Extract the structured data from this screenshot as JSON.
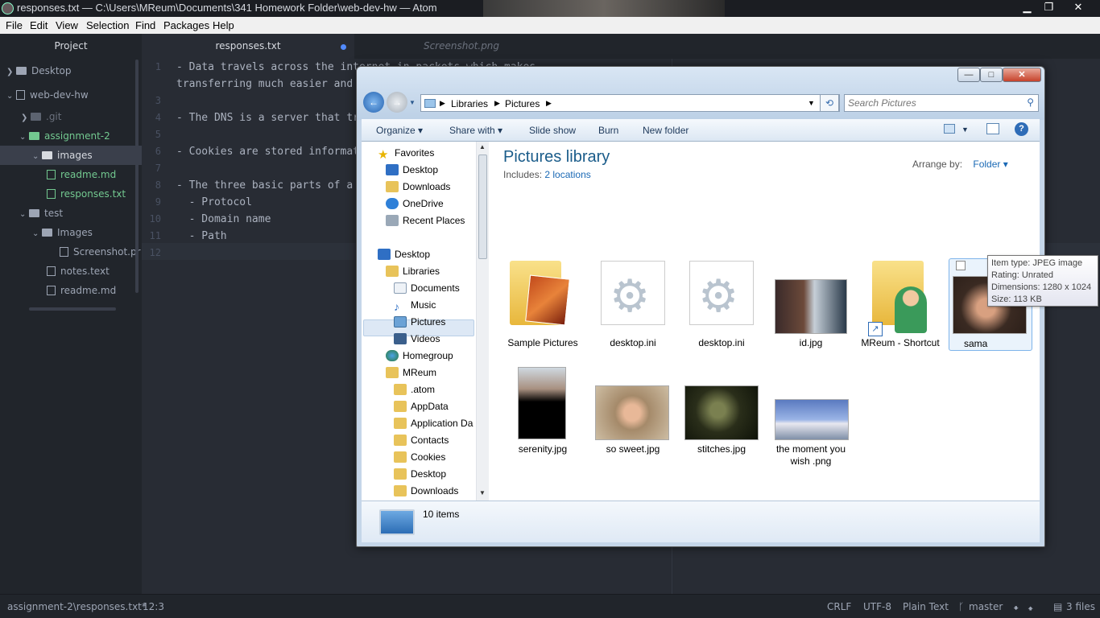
{
  "atom": {
    "window_title": "responses.txt — C:\\Users\\MReum\\Documents\\341 Homework Folder\\web-dev-hw — Atom",
    "menu": [
      "File",
      "Edit",
      "View",
      "Selection",
      "Find",
      "Packages",
      "Help"
    ],
    "tree": {
      "header": "Project",
      "items": [
        {
          "label": "Desktop"
        },
        {
          "label": "web-dev-hw"
        },
        {
          "label": ".git"
        },
        {
          "label": "assignment-2"
        },
        {
          "label": "images"
        },
        {
          "label": "readme.md"
        },
        {
          "label": "responses.txt"
        },
        {
          "label": "test"
        },
        {
          "label": "Images"
        },
        {
          "label": "Screenshot.pr"
        },
        {
          "label": "notes.text"
        },
        {
          "label": "readme.md"
        }
      ]
    },
    "tabs": [
      {
        "label": "responses.txt"
      },
      {
        "label": "Screenshot.png"
      }
    ],
    "code_lines": [
      {
        "num": "1",
        "text": "- Data travels across the internet in packets which makes"
      },
      {
        "num": "",
        "text": "transferring much easier and"
      },
      {
        "num": "3",
        "text": ""
      },
      {
        "num": "4",
        "text": "- The DNS is a server that tr"
      },
      {
        "num": "5",
        "text": ""
      },
      {
        "num": "6",
        "text": "- Cookies are stored informat"
      },
      {
        "num": "7",
        "text": ""
      },
      {
        "num": "8",
        "text": "- The three basic parts of a"
      },
      {
        "num": "9",
        "text": "  - Protocol"
      },
      {
        "num": "10",
        "text": "  - Domain name"
      },
      {
        "num": "11",
        "text": "  - Path"
      },
      {
        "num": "12",
        "text": ""
      }
    ],
    "status": {
      "file_path": "assignment-2\\responses.txt*",
      "cursor": "12:3",
      "line_ending": "CRLF",
      "encoding": "UTF-8",
      "grammar": "Plain Text",
      "branch": "master",
      "files": "3 files"
    }
  },
  "explorer": {
    "caption_buttons": {
      "minimize": "—",
      "maximize": "□",
      "close": "✕"
    },
    "address": {
      "segments": [
        "Libraries",
        "Pictures"
      ]
    },
    "search_placeholder": "Search Pictures",
    "commands": [
      "Organize",
      "Share with",
      "Slide show",
      "Burn",
      "New folder"
    ],
    "nav": {
      "favorites_header": "Favorites",
      "favorites": [
        "Desktop",
        "Downloads",
        "OneDrive",
        "Recent Places"
      ],
      "desktop_header": "Desktop",
      "tree": [
        "Libraries",
        "Documents",
        "Music",
        "Pictures",
        "Videos",
        "Homegroup",
        "MReum",
        ".atom",
        "AppData",
        "Application Da",
        "Contacts",
        "Cookies",
        "Desktop",
        "Downloads"
      ]
    },
    "library_title": "Pictures library",
    "includes_label": "Includes:",
    "includes_link": "2 locations",
    "arrange_label": "Arrange by:",
    "arrange_value": "Folder",
    "items": [
      {
        "label": "Sample Pictures"
      },
      {
        "label": "desktop.ini"
      },
      {
        "label": "desktop.ini"
      },
      {
        "label": "id.jpg"
      },
      {
        "label": "MReum - Shortcut"
      },
      {
        "label": "sama"
      },
      {
        "label": "serenity.jpg"
      },
      {
        "label": "so sweet.jpg"
      },
      {
        "label": "stitches.jpg"
      },
      {
        "label": "the moment you wish .png"
      }
    ],
    "tooltip": [
      "Item type: JPEG image",
      "Rating: Unrated",
      "Dimensions: 1280 x 1024",
      "Size: 113 KB"
    ],
    "item_count": "10 items"
  },
  "colors": {
    "atom_bg": "#282c34",
    "atom_panel": "#21252b",
    "vcs_green": "#73c990",
    "explorer_link": "#1a69b5"
  }
}
